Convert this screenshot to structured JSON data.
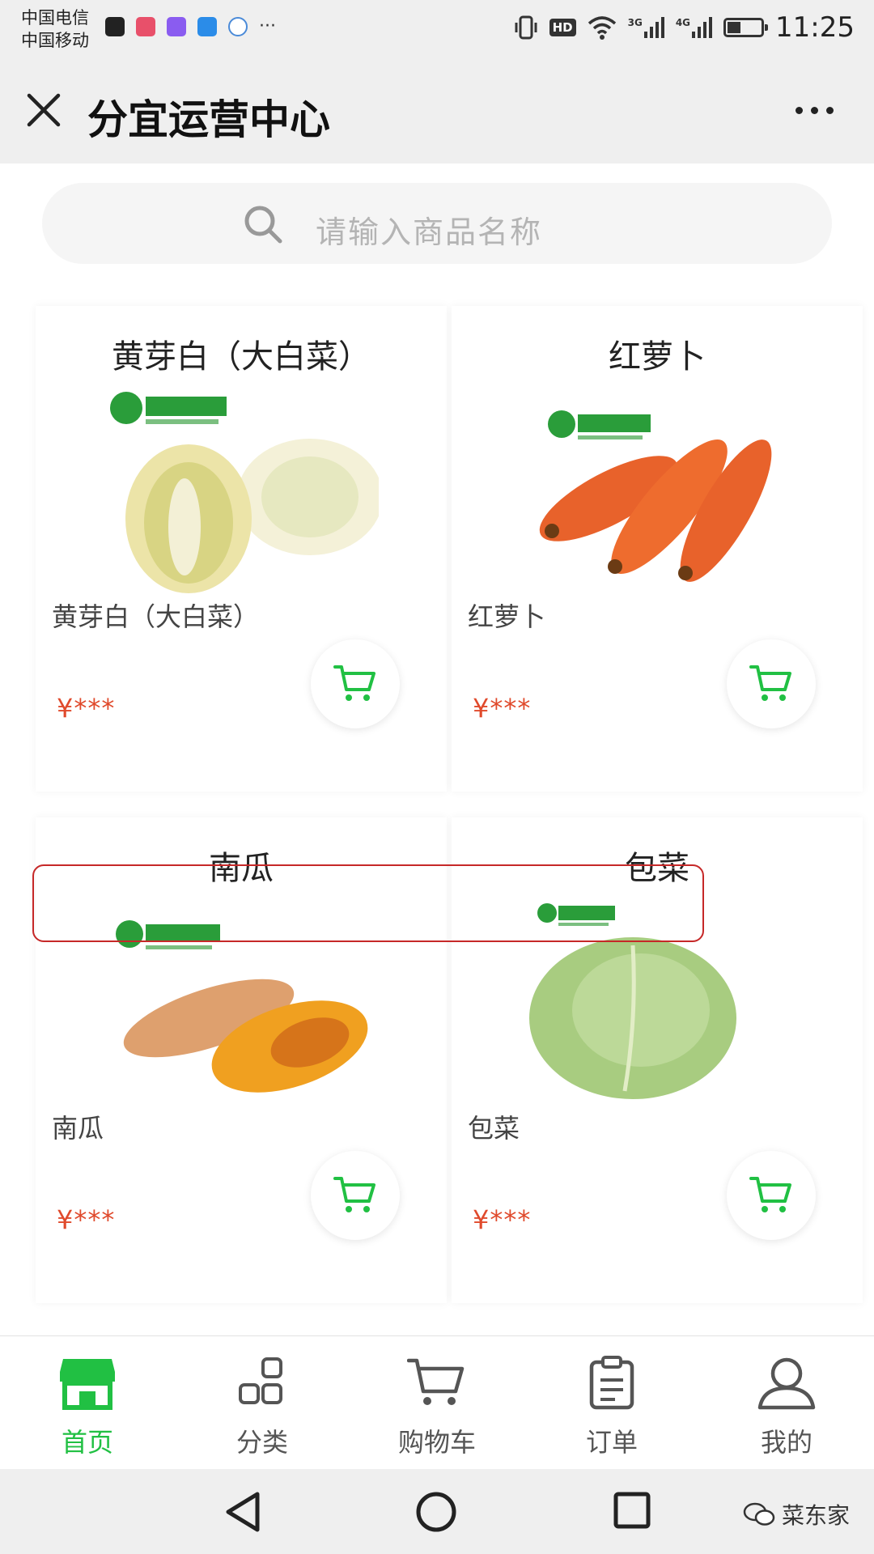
{
  "status_bar": {
    "carriers": [
      "中国电信",
      "中国移动"
    ],
    "hd": "HD",
    "net_3g": "3G",
    "net_4g": "4G",
    "time": "11:25",
    "battery_level": 0.4
  },
  "header": {
    "title": "分宜运营中心"
  },
  "search": {
    "placeholder": "请输入商品名称"
  },
  "products": [
    {
      "title": "黄芽白（大白菜）",
      "name": "黄芽白（大白菜）",
      "price": "¥***"
    },
    {
      "title": "红萝卜",
      "name": "红萝卜",
      "price": "¥***"
    },
    {
      "title": "南瓜",
      "name": "南瓜",
      "price": "¥***"
    },
    {
      "title": "包菜",
      "name": "包菜",
      "price": "¥***"
    }
  ],
  "tabs": [
    {
      "label": "首页",
      "icon": "shop-icon",
      "active": true
    },
    {
      "label": "分类",
      "icon": "category-icon",
      "active": false
    },
    {
      "label": "购物车",
      "icon": "cart-icon",
      "active": false
    },
    {
      "label": "订单",
      "icon": "order-icon",
      "active": false
    },
    {
      "label": "我的",
      "icon": "user-icon",
      "active": false
    }
  ],
  "watermark": "菜东家",
  "colors": {
    "accent_green": "#21c043",
    "price_red": "#e04a2c",
    "highlight_red": "#c62828"
  }
}
